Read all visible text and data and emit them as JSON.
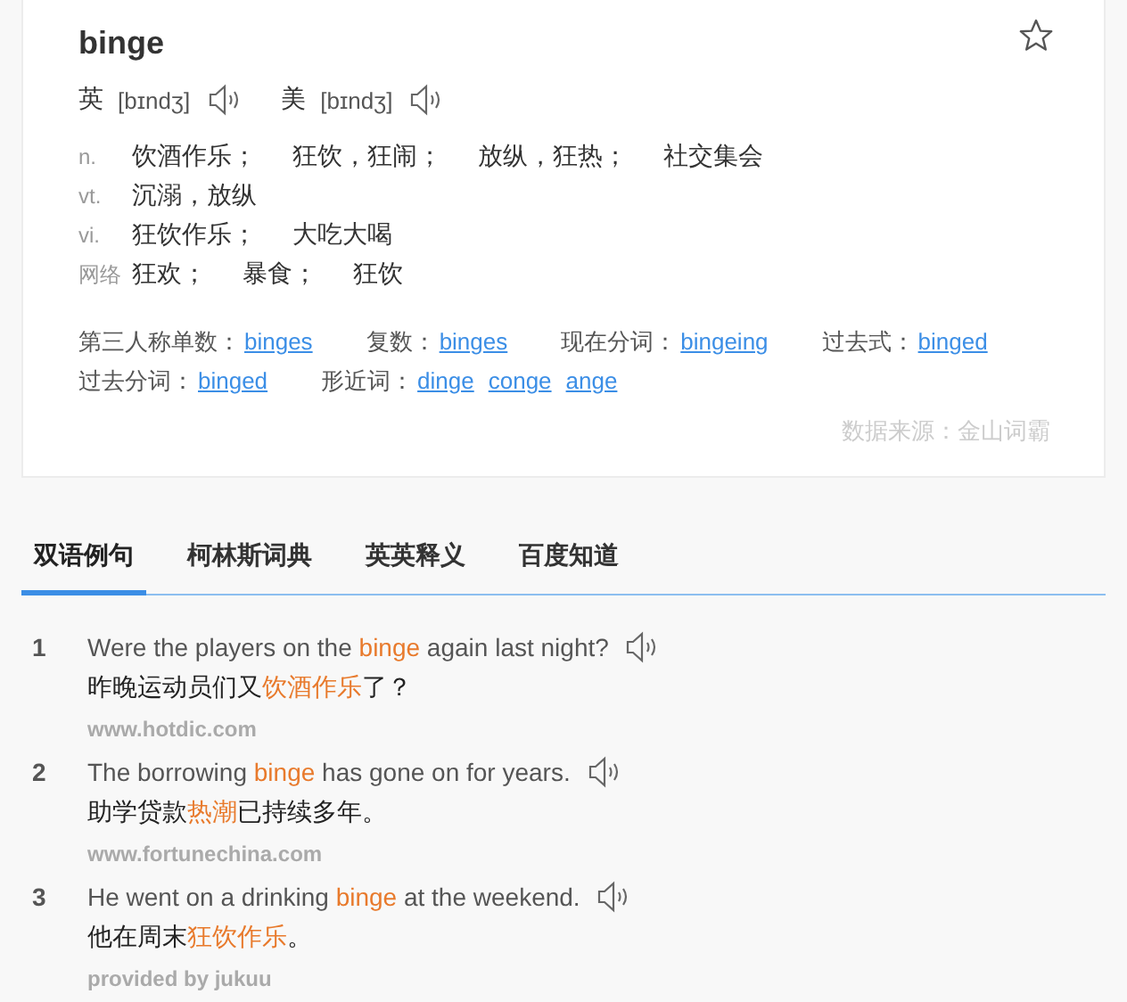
{
  "word": "binge",
  "pronunciations": [
    {
      "label": "英",
      "phonetic": "[bɪndʒ]"
    },
    {
      "label": "美",
      "phonetic": "[bɪndʒ]"
    }
  ],
  "definitions": [
    {
      "pos": "n.",
      "meanings": [
        "饮酒作乐；",
        "狂饮，狂闹；",
        "放纵，狂热；",
        "社交集会"
      ]
    },
    {
      "pos": "vt.",
      "meanings": [
        "沉溺，放纵"
      ]
    },
    {
      "pos": "vi.",
      "meanings": [
        "狂饮作乐；",
        "大吃大喝"
      ]
    },
    {
      "pos": "网络",
      "meanings": [
        "狂欢；",
        "暴食；",
        "狂饮"
      ]
    }
  ],
  "forms": [
    [
      {
        "label": "第三人称单数：",
        "links": [
          "binges"
        ]
      },
      {
        "label": "复数：",
        "links": [
          "binges"
        ]
      },
      {
        "label": "现在分词：",
        "links": [
          "bingeing"
        ]
      },
      {
        "label": "过去式：",
        "links": [
          "binged"
        ]
      }
    ],
    [
      {
        "label": "过去分词：",
        "links": [
          "binged"
        ]
      },
      {
        "label": "形近词：",
        "links": [
          "dinge",
          "conge",
          "ange"
        ]
      }
    ]
  ],
  "source": "数据来源：金山词霸",
  "tabs": [
    {
      "label": "双语例句",
      "selected": true
    },
    {
      "label": "柯林斯词典",
      "selected": false
    },
    {
      "label": "英英释义",
      "selected": false
    },
    {
      "label": "百度知道",
      "selected": false
    }
  ],
  "examples": [
    {
      "number": "1",
      "en": [
        {
          "text": "Were the players on the ",
          "highlight": false
        },
        {
          "text": "binge",
          "highlight": true
        },
        {
          "text": " again last night?",
          "highlight": false
        }
      ],
      "zh": [
        {
          "text": "昨晚运动员们又",
          "highlight": false
        },
        {
          "text": "饮酒作乐",
          "highlight": true
        },
        {
          "text": "了？",
          "highlight": false
        }
      ],
      "source": "www.hotdic.com"
    },
    {
      "number": "2",
      "en": [
        {
          "text": "The borrowing ",
          "highlight": false
        },
        {
          "text": "binge",
          "highlight": true
        },
        {
          "text": " has gone on for years.",
          "highlight": false
        }
      ],
      "zh": [
        {
          "text": "助学贷款",
          "highlight": false
        },
        {
          "text": "热潮",
          "highlight": true
        },
        {
          "text": "已持续多年。",
          "highlight": false
        }
      ],
      "source": "www.fortunechina.com"
    },
    {
      "number": "3",
      "en": [
        {
          "text": "He went on a drinking ",
          "highlight": false
        },
        {
          "text": "binge",
          "highlight": true
        },
        {
          "text": " at the weekend.",
          "highlight": false
        }
      ],
      "zh": [
        {
          "text": "他在周末",
          "highlight": false
        },
        {
          "text": "狂饮作乐",
          "highlight": true
        },
        {
          "text": "。",
          "highlight": false
        }
      ],
      "source": "provided by jukuu"
    }
  ]
}
